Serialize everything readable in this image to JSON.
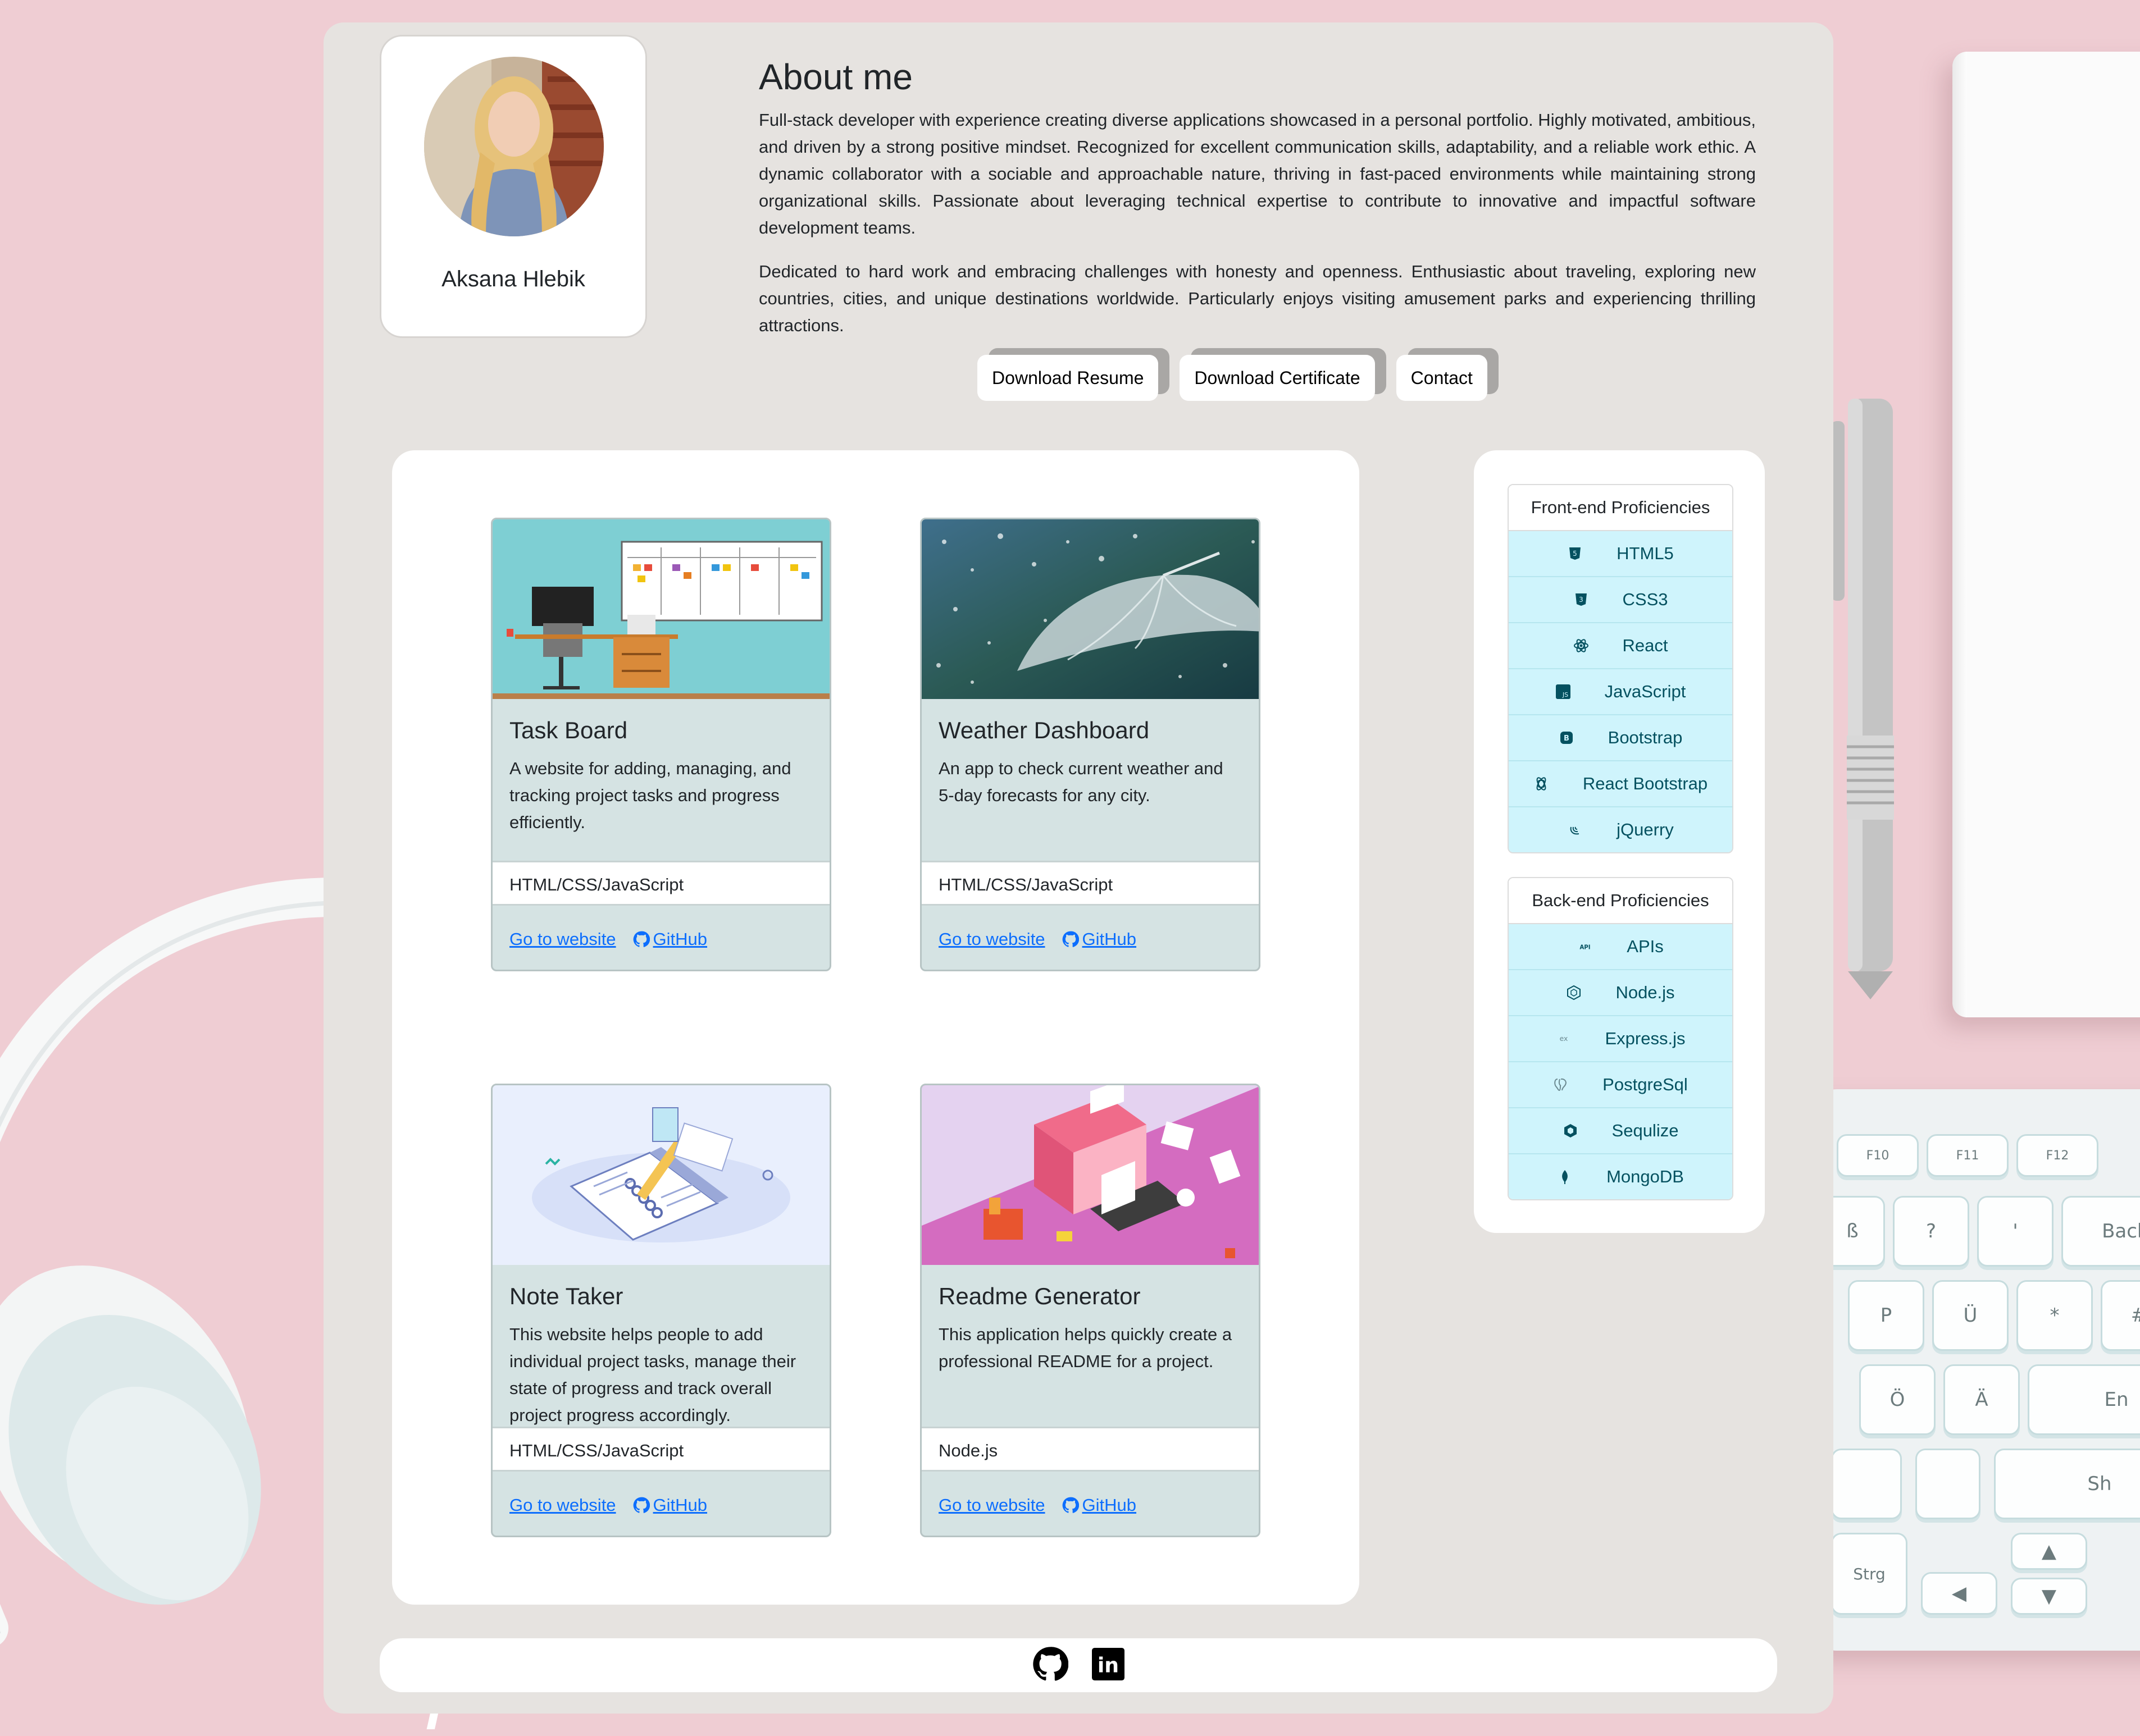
{
  "profile": {
    "name": "Aksana Hlebik"
  },
  "about": {
    "title": "About me",
    "paragraphs": [
      "Full-stack developer with experience creating diverse applications showcased in a personal portfolio. Highly motivated, ambitious, and driven by a strong positive mindset. Recognized for excellent communication skills, adaptability, and a reliable work ethic. A dynamic collaborator with a sociable and approachable nature, thriving in fast-paced environments while maintaining strong organizational skills. Passionate about leveraging technical expertise to contribute to innovative and impactful software development teams.",
      "Dedicated to hard work and embracing challenges with honesty and openness. Enthusiastic about traveling, exploring new countries, cities, and unique destinations worldwide. Particularly enjoys visiting amusement parks and experiencing thrilling attractions."
    ],
    "buttons": [
      "Download Resume",
      "Download Certificate",
      "Contact"
    ]
  },
  "projects": [
    {
      "title": "Task Board",
      "description": "A website for adding, managing, and tracking project tasks and progress efficiently.",
      "tech": "HTML/CSS/JavaScript",
      "website_label": "Go to website",
      "github_label": "GitHub",
      "image": "office-desk-with-task-board-illustration"
    },
    {
      "title": "Weather Dashboard",
      "description": "An app to check current weather and 5-day forecasts for any city.",
      "tech": "HTML/CSS/JavaScript",
      "website_label": "Go to website",
      "github_label": "GitHub",
      "image": "umbrella-in-rain-photo"
    },
    {
      "title": "Note Taker",
      "description": "This website helps people to add individual project tasks, manage their state of progress and track overall project progress accordingly.",
      "tech": "HTML/CSS/JavaScript",
      "website_label": "Go to website",
      "github_label": "GitHub",
      "image": "notebook-and-pen-illustration"
    },
    {
      "title": "Readme Generator",
      "description": "This application helps quickly create a professional README for a project.",
      "tech": "Node.js",
      "website_label": "Go to website",
      "github_label": "GitHub",
      "image": "isometric-workspace-illustration"
    }
  ],
  "skills": {
    "frontend": {
      "title": "Front-end Proficiencies",
      "items": [
        {
          "label": "HTML5",
          "icon": "html5-icon"
        },
        {
          "label": "CSS3",
          "icon": "css3-icon"
        },
        {
          "label": "React",
          "icon": "react-icon"
        },
        {
          "label": "JavaScript",
          "icon": "javascript-icon"
        },
        {
          "label": "Bootstrap",
          "icon": "bootstrap-icon"
        },
        {
          "label": "React Bootstrap",
          "icon": "react-bootstrap-icon"
        },
        {
          "label": "jQuerry",
          "icon": "jquery-icon"
        }
      ]
    },
    "backend": {
      "title": "Back-end Proficiencies",
      "items": [
        {
          "label": "APIs",
          "icon": "api-icon"
        },
        {
          "label": "Node.js",
          "icon": "nodejs-icon"
        },
        {
          "label": "Express.js",
          "icon": "express-icon"
        },
        {
          "label": "PostgreSql",
          "icon": "postgresql-icon"
        },
        {
          "label": "Sequlize",
          "icon": "sequelize-icon"
        },
        {
          "label": "MongoDB",
          "icon": "mongodb-icon"
        }
      ]
    }
  },
  "footer": {
    "icons": [
      "github-icon",
      "linkedin-icon"
    ]
  },
  "icon_texts": {
    "api": "API",
    "js": "JS",
    "bootstrap": "B",
    "express": "ex",
    "html5": "5",
    "css3": "3",
    "linkedin": "in"
  },
  "keyboard": {
    "keys": [
      "F10",
      "F11",
      "F12",
      "Backsp",
      "?",
      "ß",
      "P",
      "Ü",
      "*",
      "+",
      "~",
      "Ö",
      "Ä",
      "En",
      "Sh",
      "Strg",
      "#",
      "'"
    ]
  },
  "colors": {
    "page_background": "#efcdd3",
    "panel": "#e6e3e0",
    "card": "#d5e3e3",
    "skill_item": "#cff4fc",
    "skill_text": "#055160",
    "link": "#0d6efd"
  }
}
